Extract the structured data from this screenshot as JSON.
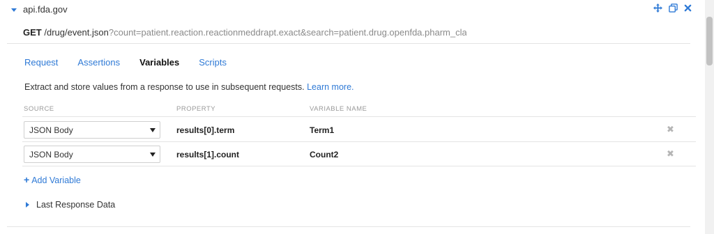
{
  "header": {
    "host": "api.fda.gov",
    "icons": [
      "move-icon",
      "duplicate-icon",
      "close-icon"
    ]
  },
  "request_line": {
    "method": "GET",
    "path": "/drug/event.json",
    "query": "?count=patient.reaction.reactionmeddrapt.exact&search=patient.drug.openfda.pharm_class_e"
  },
  "tabs": [
    {
      "label": "Request",
      "active": false
    },
    {
      "label": "Assertions",
      "active": false
    },
    {
      "label": "Variables",
      "active": true
    },
    {
      "label": "Scripts",
      "active": false
    }
  ],
  "description": {
    "text": "Extract and store values from a response to use in subsequent requests.",
    "link": "Learn more."
  },
  "columns": {
    "source": "SOURCE",
    "property": "PROPERTY",
    "variable_name": "VARIABLE NAME"
  },
  "rows": [
    {
      "source": "JSON Body",
      "property": "results[0].term",
      "variable": "Term1"
    },
    {
      "source": "JSON Body",
      "property": "results[1].count",
      "variable": "Count2"
    }
  ],
  "add_variable_label": "Add Variable",
  "last_response_label": "Last Response Data",
  "colors": {
    "accent": "#2f7ad6",
    "muted": "#8a8a8a",
    "divider": "#e4e4e4"
  }
}
